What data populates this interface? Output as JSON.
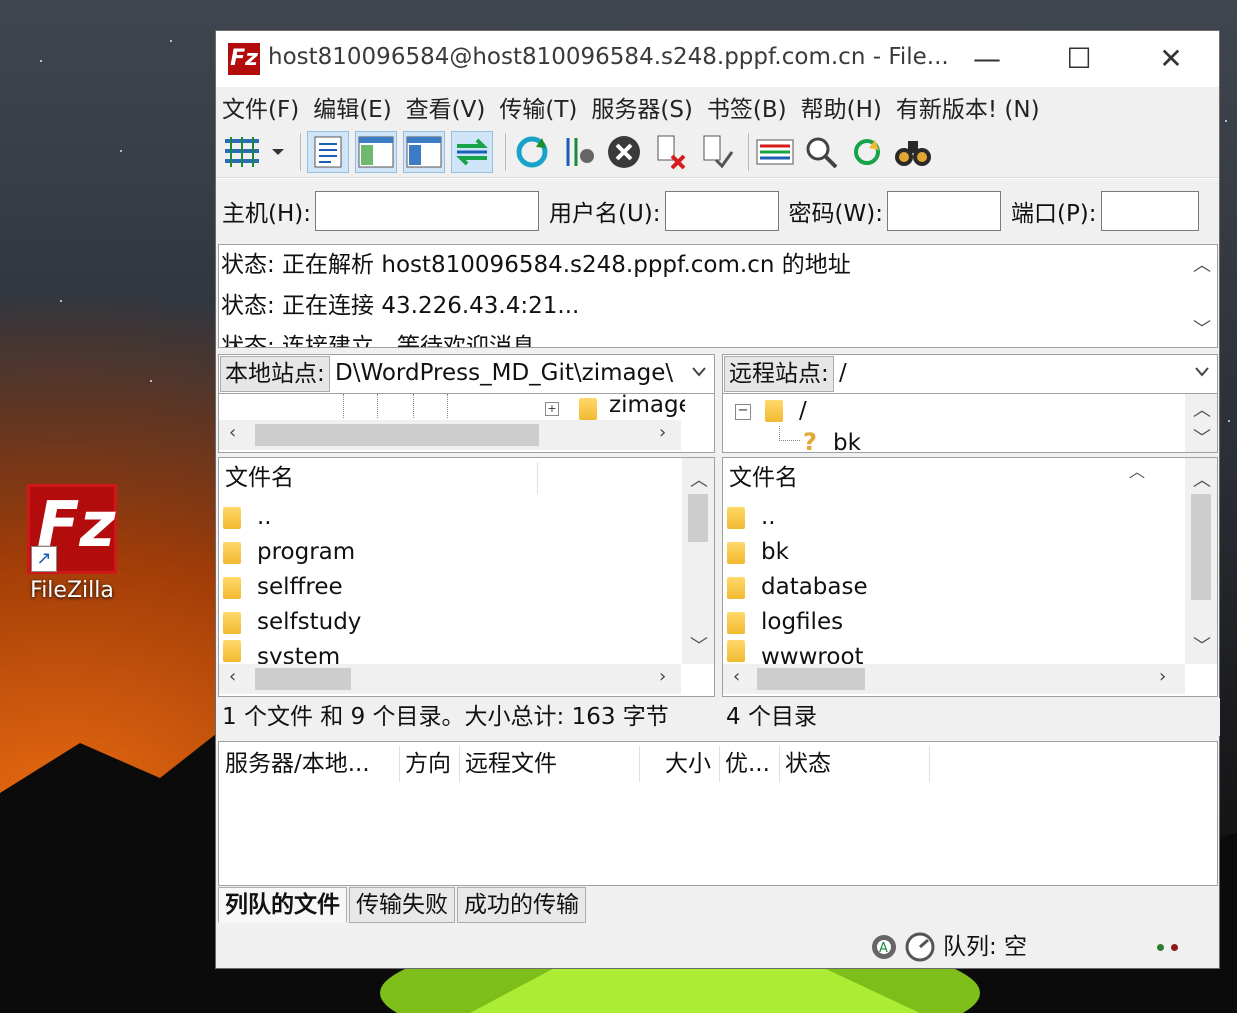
{
  "desktop": {
    "icon_label": "FileZilla"
  },
  "window": {
    "title": "host810096584@host810096584.s248.pppf.com.cn - File...",
    "controls": {
      "minimize": "—",
      "maximize": "☐",
      "close": "✕"
    }
  },
  "menu": [
    "文件(F)",
    "编辑(E)",
    "查看(V)",
    "传输(T)",
    "服务器(S)",
    "书签(B)",
    "帮助(H)",
    "有新版本! (N)"
  ],
  "quickconnect": {
    "host_label": "主机(H):",
    "user_label": "用户名(U):",
    "pass_label": "密码(W):",
    "port_label": "端口(P):",
    "host_value": "",
    "user_value": "",
    "pass_value": "",
    "port_value": ""
  },
  "log": [
    "状态:  正在解析 host810096584.s248.pppf.com.cn 的地址",
    "状态:  正在连接 43.226.43.4:21...",
    "状态:  连接建立，等待欢迎消息..."
  ],
  "local": {
    "site_label": "本地站点:",
    "path": "D\\WordPress_MD_Git\\zimage\\",
    "tree_item": "zimage",
    "column_filename": "文件名",
    "files": [
      "..",
      "program",
      "selffree",
      "selfstudy",
      "system"
    ],
    "summary": "1 个文件 和 9 个目录。大小总计: 163 字节"
  },
  "remote": {
    "site_label": "远程站点:",
    "path": "/",
    "tree_root": "/",
    "tree_child": "bk",
    "column_filename": "文件名",
    "files": [
      "..",
      "bk",
      "database",
      "logfiles",
      "wwwroot"
    ],
    "summary": "4 个目录"
  },
  "queue": {
    "columns": [
      "服务器/本地...",
      "方向",
      "远程文件",
      "大小",
      "优...",
      "状态"
    ]
  },
  "tabs": [
    "列队的文件",
    "传输失败",
    "成功的传输"
  ],
  "statusbar": {
    "queue_text": "队列: 空"
  },
  "colors": {
    "brand_red": "#b30c0c",
    "folder_yellow": "#f2b930",
    "selected_tool": "#cfe4f7"
  }
}
